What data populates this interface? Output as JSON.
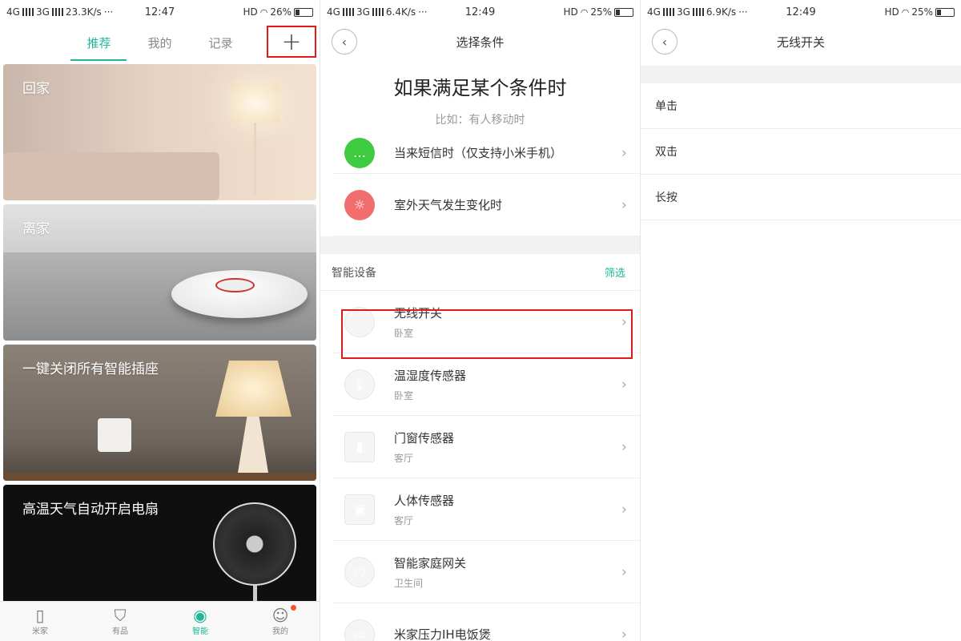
{
  "panel1": {
    "status": {
      "signal1": "4G",
      "signal2": "3G",
      "speed": "23.3K/s",
      "time": "12:47",
      "hd": "HD",
      "battery": "26%"
    },
    "tabs": [
      "推荐",
      "我的",
      "记录"
    ],
    "add_label": "+",
    "cards": [
      "回家",
      "离家",
      "一键关闭所有智能插座",
      "高温天气自动开启电扇"
    ],
    "bottom_nav": [
      {
        "label": "米家",
        "icon": "door-icon"
      },
      {
        "label": "有品",
        "icon": "shopping-bag-icon"
      },
      {
        "label": "智能",
        "icon": "smart-camera-icon"
      },
      {
        "label": "我的",
        "icon": "profile-icon"
      }
    ]
  },
  "panel2": {
    "status": {
      "signal1": "4G",
      "signal2": "3G",
      "speed": "6.4K/s",
      "time": "12:49",
      "hd": "HD",
      "battery": "25%"
    },
    "title": "选择条件",
    "big_title": "如果满足某个条件时",
    "subtitle": "比如：有人移动时",
    "conditions": [
      {
        "label": "当来短信时（仅支持小米手机）",
        "icon": "message-icon",
        "color": "#3fcb3f"
      },
      {
        "label": "室外天气发生变化时",
        "icon": "weather-icon",
        "color": "#f26d6d"
      }
    ],
    "section_title": "智能设备",
    "filter_label": "筛选",
    "devices": [
      {
        "name": "无线开关",
        "room": "卧室"
      },
      {
        "name": "温湿度传感器",
        "room": "卧室"
      },
      {
        "name": "门窗传感器",
        "room": "客厅"
      },
      {
        "name": "人体传感器",
        "room": "客厅"
      },
      {
        "name": "智能家庭网关",
        "room": "卫生间"
      },
      {
        "name": "米家压力IH电饭煲",
        "room": ""
      }
    ]
  },
  "panel3": {
    "status": {
      "signal1": "4G",
      "signal2": "3G",
      "speed": "6.9K/s",
      "time": "12:49",
      "hd": "HD",
      "battery": "25%"
    },
    "title": "无线开关",
    "options": [
      "单击",
      "双击",
      "长按"
    ]
  },
  "colors": {
    "accent": "#20b69b",
    "highlight": "#e01919",
    "badge": "#f3542c"
  }
}
